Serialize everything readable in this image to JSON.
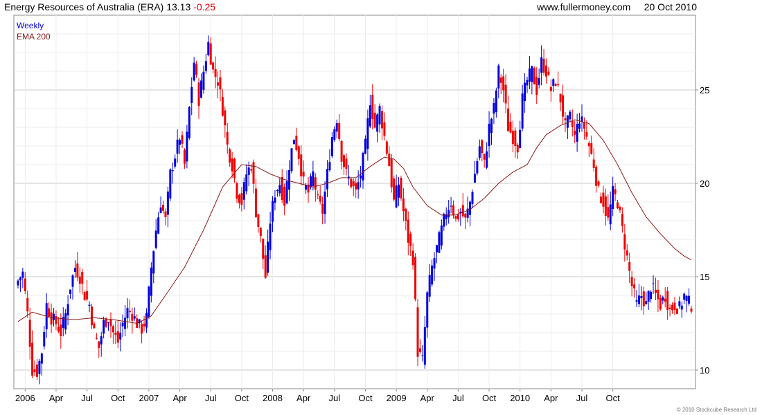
{
  "header": {
    "title": "Energy Resources of Australia (ERA)",
    "price": "13.13",
    "change": "-0.25",
    "site": "www.fullermoney.com",
    "date": "20 Oct 2010"
  },
  "legend": {
    "weekly": "Weekly",
    "ema": "EMA 200"
  },
  "copyright": "© 2010 Stockcube Research Ltd",
  "colors": {
    "up": "#0000dd",
    "down": "#ee0000",
    "ema": "#8b1a1a",
    "grid": "#dcdcdc",
    "axis": "#888888"
  },
  "chart_data": {
    "type": "candlestick",
    "title": "Energy Resources of Australia (ERA)",
    "xlabel": "",
    "ylabel": "",
    "ylim": [
      9,
      29
    ],
    "yticks": [
      10,
      15,
      20,
      25
    ],
    "grid": true,
    "x_tick_labels": [
      "2006",
      "Apr",
      "Jul",
      "Oct",
      "2007",
      "Apr",
      "Jul",
      "Oct",
      "2008",
      "Apr",
      "Jul",
      "Oct",
      "2009",
      "Apr",
      "Jul",
      "Oct",
      "2010",
      "Apr",
      "Jul",
      "Oct"
    ],
    "series": [
      {
        "name": "Weekly",
        "interval": "week",
        "anchors": [
          [
            0,
            14.8
          ],
          [
            2,
            15.2
          ],
          [
            4,
            13.0
          ],
          [
            5,
            11.5
          ],
          [
            6,
            10.0
          ],
          [
            8,
            9.9
          ],
          [
            10,
            11.0
          ],
          [
            12,
            13.5
          ],
          [
            14,
            12.8
          ],
          [
            16,
            12.5
          ],
          [
            18,
            12.0
          ],
          [
            20,
            13.0
          ],
          [
            22,
            14.5
          ],
          [
            24,
            15.5
          ],
          [
            26,
            15.0
          ],
          [
            28,
            14.0
          ],
          [
            30,
            13.5
          ],
          [
            32,
            12.0
          ],
          [
            34,
            11.2
          ],
          [
            36,
            12.5
          ],
          [
            38,
            12.8
          ],
          [
            40,
            12.0
          ],
          [
            42,
            11.5
          ],
          [
            44,
            12.5
          ],
          [
            46,
            13.2
          ],
          [
            48,
            13.0
          ],
          [
            50,
            12.5
          ],
          [
            52,
            12.2
          ],
          [
            54,
            12.8
          ],
          [
            56,
            15.5
          ],
          [
            58,
            17.5
          ],
          [
            60,
            19.0
          ],
          [
            62,
            18.0
          ],
          [
            64,
            20.5
          ],
          [
            66,
            21.5
          ],
          [
            68,
            22.5
          ],
          [
            70,
            21.0
          ],
          [
            72,
            24.0
          ],
          [
            74,
            26.5
          ],
          [
            76,
            24.5
          ],
          [
            78,
            26.0
          ],
          [
            80,
            27.5
          ],
          [
            82,
            26.0
          ],
          [
            84,
            25.5
          ],
          [
            86,
            24.0
          ],
          [
            88,
            22.0
          ],
          [
            90,
            21.0
          ],
          [
            92,
            19.5
          ],
          [
            94,
            19.0
          ],
          [
            96,
            20.5
          ],
          [
            98,
            21.0
          ],
          [
            100,
            18.5
          ],
          [
            102,
            17.0
          ],
          [
            104,
            15.0
          ],
          [
            106,
            18.0
          ],
          [
            108,
            19.5
          ],
          [
            110,
            20.0
          ],
          [
            112,
            19.0
          ],
          [
            114,
            21.0
          ],
          [
            116,
            22.5
          ],
          [
            118,
            21.5
          ],
          [
            120,
            20.0
          ],
          [
            122,
            19.5
          ],
          [
            124,
            20.5
          ],
          [
            126,
            19.0
          ],
          [
            128,
            18.5
          ],
          [
            130,
            20.5
          ],
          [
            132,
            22.5
          ],
          [
            134,
            23.5
          ],
          [
            136,
            21.5
          ],
          [
            138,
            20.5
          ],
          [
            140,
            20.0
          ],
          [
            142,
            19.5
          ],
          [
            144,
            20.5
          ],
          [
            146,
            22.0
          ],
          [
            148,
            24.5
          ],
          [
            150,
            23.0
          ],
          [
            152,
            24.0
          ],
          [
            154,
            22.5
          ],
          [
            156,
            21.0
          ],
          [
            158,
            19.0
          ],
          [
            160,
            20.0
          ],
          [
            162,
            18.5
          ],
          [
            164,
            17.0
          ],
          [
            166,
            16.0
          ],
          [
            168,
            11.0
          ],
          [
            170,
            10.5
          ],
          [
            172,
            14.0
          ],
          [
            174,
            15.5
          ],
          [
            176,
            16.5
          ],
          [
            178,
            17.5
          ],
          [
            180,
            18.5
          ],
          [
            182,
            19.0
          ],
          [
            184,
            18.0
          ],
          [
            186,
            18.5
          ],
          [
            188,
            18.0
          ],
          [
            190,
            19.0
          ],
          [
            192,
            20.5
          ],
          [
            194,
            22.0
          ],
          [
            196,
            21.0
          ],
          [
            198,
            23.0
          ],
          [
            200,
            24.0
          ],
          [
            202,
            26.0
          ],
          [
            204,
            25.0
          ],
          [
            206,
            23.0
          ],
          [
            208,
            22.5
          ],
          [
            210,
            22.0
          ],
          [
            212,
            24.5
          ],
          [
            214,
            25.5
          ],
          [
            216,
            26.0
          ],
          [
            218,
            25.0
          ],
          [
            220,
            26.5
          ],
          [
            222,
            26.0
          ],
          [
            224,
            25.0
          ],
          [
            226,
            25.5
          ],
          [
            228,
            24.5
          ],
          [
            230,
            23.0
          ],
          [
            232,
            23.5
          ],
          [
            234,
            22.5
          ],
          [
            236,
            23.5
          ],
          [
            238,
            23.0
          ],
          [
            240,
            22.0
          ],
          [
            242,
            21.0
          ],
          [
            244,
            19.5
          ],
          [
            246,
            19.0
          ],
          [
            248,
            18.0
          ],
          [
            250,
            19.5
          ],
          [
            252,
            19.0
          ],
          [
            254,
            17.5
          ],
          [
            256,
            16.0
          ],
          [
            258,
            14.5
          ],
          [
            260,
            13.5
          ],
          [
            262,
            14.0
          ],
          [
            264,
            13.5
          ],
          [
            266,
            14.5
          ],
          [
            268,
            14.0
          ],
          [
            270,
            13.5
          ],
          [
            272,
            14.0
          ],
          [
            274,
            13.2
          ],
          [
            276,
            13.5
          ],
          [
            278,
            13.3
          ],
          [
            280,
            14.0
          ],
          [
            282,
            13.6
          ],
          [
            283,
            13.13
          ]
        ]
      },
      {
        "name": "EMA 200",
        "points": [
          [
            0,
            12.6
          ],
          [
            6,
            13.1
          ],
          [
            14,
            12.8
          ],
          [
            24,
            12.7
          ],
          [
            32,
            12.8
          ],
          [
            40,
            12.7
          ],
          [
            50,
            12.5
          ],
          [
            56,
            12.9
          ],
          [
            62,
            14.0
          ],
          [
            70,
            15.5
          ],
          [
            78,
            17.5
          ],
          [
            86,
            19.8
          ],
          [
            94,
            21.0
          ],
          [
            100,
            20.9
          ],
          [
            106,
            20.5
          ],
          [
            112,
            20.2
          ],
          [
            118,
            20.0
          ],
          [
            124,
            19.8
          ],
          [
            130,
            20.0
          ],
          [
            136,
            20.3
          ],
          [
            142,
            20.3
          ],
          [
            148,
            20.9
          ],
          [
            154,
            21.4
          ],
          [
            158,
            21.3
          ],
          [
            162,
            20.8
          ],
          [
            166,
            19.8
          ],
          [
            172,
            18.8
          ],
          [
            178,
            18.3
          ],
          [
            184,
            18.3
          ],
          [
            190,
            18.6
          ],
          [
            196,
            19.2
          ],
          [
            202,
            20.0
          ],
          [
            208,
            20.6
          ],
          [
            214,
            21.0
          ],
          [
            218,
            21.9
          ],
          [
            222,
            22.6
          ],
          [
            228,
            23.1
          ],
          [
            234,
            23.4
          ],
          [
            240,
            23.2
          ],
          [
            246,
            22.3
          ],
          [
            252,
            21.0
          ],
          [
            258,
            19.5
          ],
          [
            264,
            18.2
          ],
          [
            270,
            17.3
          ],
          [
            276,
            16.5
          ],
          [
            280,
            16.1
          ],
          [
            283,
            15.9
          ]
        ]
      }
    ]
  }
}
